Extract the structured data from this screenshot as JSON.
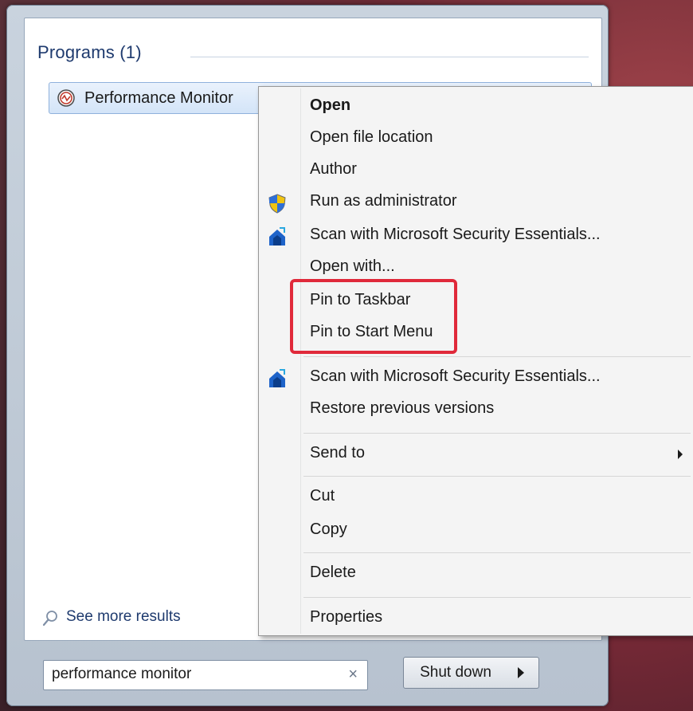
{
  "programs": {
    "header": "Programs (1)",
    "result_label": "Performance Monitor"
  },
  "see_more": {
    "label": "See more results"
  },
  "search": {
    "value": "performance monitor",
    "clear_glyph": "×"
  },
  "shutdown": {
    "label": "Shut down"
  },
  "context_menu": {
    "items": [
      {
        "label": "Open",
        "bold": true
      },
      {
        "label": "Open file location"
      },
      {
        "label": "Author"
      },
      {
        "label": "Run as administrator",
        "icon": "uac-shield-icon"
      },
      {
        "label": "Scan with Microsoft Security Essentials...",
        "icon": "security-essentials-icon"
      },
      {
        "label": "Open with..."
      },
      {
        "label": "Pin to Taskbar"
      },
      {
        "label": "Pin to Start Menu"
      },
      {
        "label": "Scan with Microsoft Security Essentials...",
        "icon": "security-essentials-icon"
      },
      {
        "label": "Restore previous versions"
      },
      {
        "label": "Send to",
        "submenu": true
      },
      {
        "label": "Cut"
      },
      {
        "label": "Copy"
      },
      {
        "label": "Delete"
      },
      {
        "label": "Properties"
      }
    ]
  },
  "colors": {
    "highlight": "#e0293a",
    "header_text": "#1e3a6e",
    "menu_background": "#f4f4f4"
  }
}
